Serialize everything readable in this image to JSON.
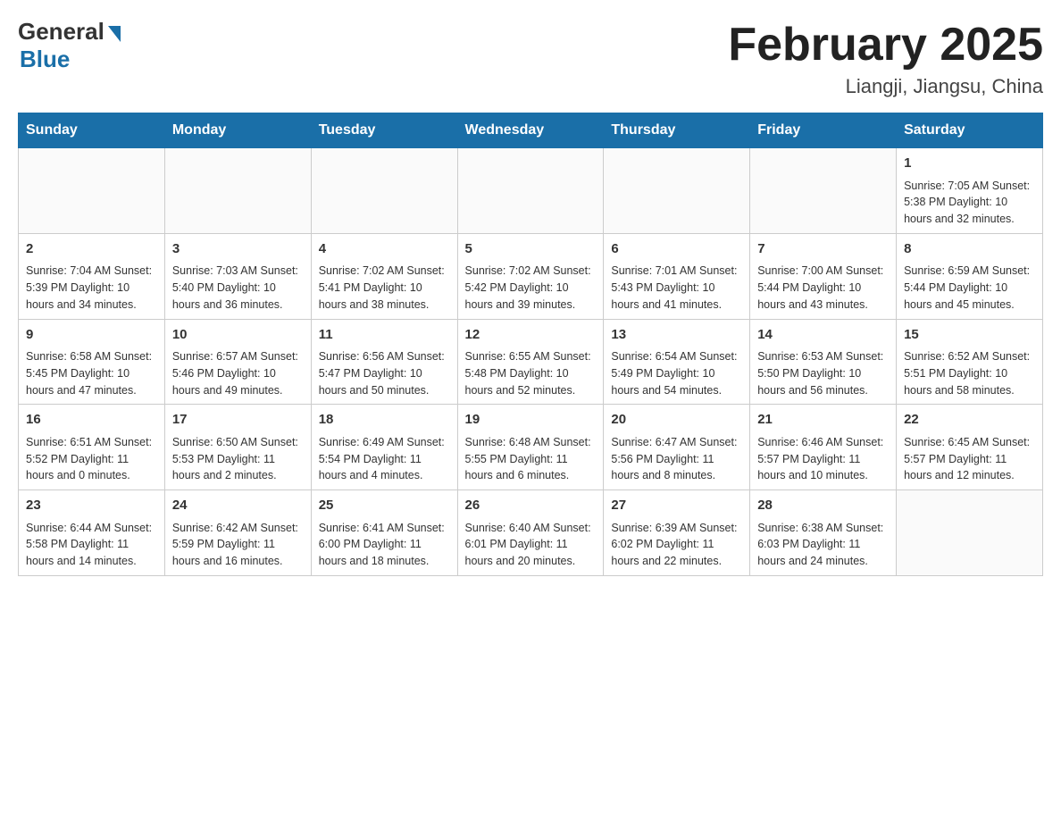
{
  "header": {
    "logo_general": "General",
    "logo_blue": "Blue",
    "month_title": "February 2025",
    "location": "Liangji, Jiangsu, China"
  },
  "days_of_week": [
    "Sunday",
    "Monday",
    "Tuesday",
    "Wednesday",
    "Thursday",
    "Friday",
    "Saturday"
  ],
  "weeks": [
    [
      {
        "day": "",
        "info": ""
      },
      {
        "day": "",
        "info": ""
      },
      {
        "day": "",
        "info": ""
      },
      {
        "day": "",
        "info": ""
      },
      {
        "day": "",
        "info": ""
      },
      {
        "day": "",
        "info": ""
      },
      {
        "day": "1",
        "info": "Sunrise: 7:05 AM\nSunset: 5:38 PM\nDaylight: 10 hours and 32 minutes."
      }
    ],
    [
      {
        "day": "2",
        "info": "Sunrise: 7:04 AM\nSunset: 5:39 PM\nDaylight: 10 hours and 34 minutes."
      },
      {
        "day": "3",
        "info": "Sunrise: 7:03 AM\nSunset: 5:40 PM\nDaylight: 10 hours and 36 minutes."
      },
      {
        "day": "4",
        "info": "Sunrise: 7:02 AM\nSunset: 5:41 PM\nDaylight: 10 hours and 38 minutes."
      },
      {
        "day": "5",
        "info": "Sunrise: 7:02 AM\nSunset: 5:42 PM\nDaylight: 10 hours and 39 minutes."
      },
      {
        "day": "6",
        "info": "Sunrise: 7:01 AM\nSunset: 5:43 PM\nDaylight: 10 hours and 41 minutes."
      },
      {
        "day": "7",
        "info": "Sunrise: 7:00 AM\nSunset: 5:44 PM\nDaylight: 10 hours and 43 minutes."
      },
      {
        "day": "8",
        "info": "Sunrise: 6:59 AM\nSunset: 5:44 PM\nDaylight: 10 hours and 45 minutes."
      }
    ],
    [
      {
        "day": "9",
        "info": "Sunrise: 6:58 AM\nSunset: 5:45 PM\nDaylight: 10 hours and 47 minutes."
      },
      {
        "day": "10",
        "info": "Sunrise: 6:57 AM\nSunset: 5:46 PM\nDaylight: 10 hours and 49 minutes."
      },
      {
        "day": "11",
        "info": "Sunrise: 6:56 AM\nSunset: 5:47 PM\nDaylight: 10 hours and 50 minutes."
      },
      {
        "day": "12",
        "info": "Sunrise: 6:55 AM\nSunset: 5:48 PM\nDaylight: 10 hours and 52 minutes."
      },
      {
        "day": "13",
        "info": "Sunrise: 6:54 AM\nSunset: 5:49 PM\nDaylight: 10 hours and 54 minutes."
      },
      {
        "day": "14",
        "info": "Sunrise: 6:53 AM\nSunset: 5:50 PM\nDaylight: 10 hours and 56 minutes."
      },
      {
        "day": "15",
        "info": "Sunrise: 6:52 AM\nSunset: 5:51 PM\nDaylight: 10 hours and 58 minutes."
      }
    ],
    [
      {
        "day": "16",
        "info": "Sunrise: 6:51 AM\nSunset: 5:52 PM\nDaylight: 11 hours and 0 minutes."
      },
      {
        "day": "17",
        "info": "Sunrise: 6:50 AM\nSunset: 5:53 PM\nDaylight: 11 hours and 2 minutes."
      },
      {
        "day": "18",
        "info": "Sunrise: 6:49 AM\nSunset: 5:54 PM\nDaylight: 11 hours and 4 minutes."
      },
      {
        "day": "19",
        "info": "Sunrise: 6:48 AM\nSunset: 5:55 PM\nDaylight: 11 hours and 6 minutes."
      },
      {
        "day": "20",
        "info": "Sunrise: 6:47 AM\nSunset: 5:56 PM\nDaylight: 11 hours and 8 minutes."
      },
      {
        "day": "21",
        "info": "Sunrise: 6:46 AM\nSunset: 5:57 PM\nDaylight: 11 hours and 10 minutes."
      },
      {
        "day": "22",
        "info": "Sunrise: 6:45 AM\nSunset: 5:57 PM\nDaylight: 11 hours and 12 minutes."
      }
    ],
    [
      {
        "day": "23",
        "info": "Sunrise: 6:44 AM\nSunset: 5:58 PM\nDaylight: 11 hours and 14 minutes."
      },
      {
        "day": "24",
        "info": "Sunrise: 6:42 AM\nSunset: 5:59 PM\nDaylight: 11 hours and 16 minutes."
      },
      {
        "day": "25",
        "info": "Sunrise: 6:41 AM\nSunset: 6:00 PM\nDaylight: 11 hours and 18 minutes."
      },
      {
        "day": "26",
        "info": "Sunrise: 6:40 AM\nSunset: 6:01 PM\nDaylight: 11 hours and 20 minutes."
      },
      {
        "day": "27",
        "info": "Sunrise: 6:39 AM\nSunset: 6:02 PM\nDaylight: 11 hours and 22 minutes."
      },
      {
        "day": "28",
        "info": "Sunrise: 6:38 AM\nSunset: 6:03 PM\nDaylight: 11 hours and 24 minutes."
      },
      {
        "day": "",
        "info": ""
      }
    ]
  ]
}
